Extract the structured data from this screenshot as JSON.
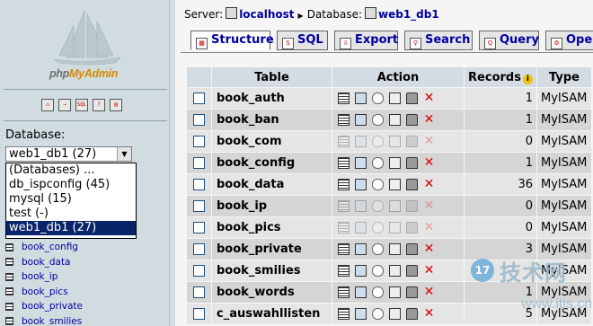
{
  "left": {
    "logo_php": "php",
    "logo_admin": "MyAdmin",
    "icons": [
      "home-icon",
      "exit-icon",
      "sql-query-icon",
      "help-icon",
      "docs-icon"
    ],
    "database_label": "Database:",
    "database_selected": "web1_db1 (27)",
    "database_options": [
      "(Databases) ...",
      "db_ispconfig (45)",
      "mysql (15)",
      "test (-)",
      "web1_db1 (27)"
    ],
    "table_list": [
      "book_config",
      "book_data",
      "book_ip",
      "book_pics",
      "book_private",
      "book_smilies"
    ]
  },
  "breadcrumb": {
    "server_label": "Server:",
    "server": "localhost",
    "database_label": "Database:",
    "database": "web1_db1"
  },
  "tabs": [
    {
      "label": "Structure",
      "icon": "structure-icon",
      "active": true
    },
    {
      "label": "SQL",
      "icon": "sql-icon"
    },
    {
      "label": "Export",
      "icon": "export-icon"
    },
    {
      "label": "Search",
      "icon": "search-icon"
    },
    {
      "label": "Query",
      "icon": "query-icon"
    },
    {
      "label": "Oper",
      "icon": "operations-icon"
    }
  ],
  "table": {
    "headers": {
      "table": "Table",
      "action": "Action",
      "records": "Records",
      "type": "Type"
    },
    "rows": [
      {
        "name": "book_auth",
        "records": "1",
        "type": "MyISAM",
        "empty": false
      },
      {
        "name": "book_ban",
        "records": "1",
        "type": "MyISAM",
        "empty": false
      },
      {
        "name": "book_com",
        "records": "0",
        "type": "MyISAM",
        "empty": true
      },
      {
        "name": "book_config",
        "records": "1",
        "type": "MyISAM",
        "empty": false
      },
      {
        "name": "book_data",
        "records": "36",
        "type": "MyISAM",
        "empty": false
      },
      {
        "name": "book_ip",
        "records": "0",
        "type": "MyISAM",
        "empty": true
      },
      {
        "name": "book_pics",
        "records": "0",
        "type": "MyISAM",
        "empty": true
      },
      {
        "name": "book_private",
        "records": "3",
        "type": "MyISAM",
        "empty": false
      },
      {
        "name": "book_smilies",
        "records": "",
        "type": "MyISAM",
        "empty": false
      },
      {
        "name": "book_words",
        "records": "1",
        "type": "MyISAM",
        "empty": false
      },
      {
        "name": "c_auswahllisten",
        "records": "5",
        "type": "MyISAM",
        "empty": false
      }
    ]
  },
  "watermark": {
    "num": "17",
    "text": "技术网",
    "url": "www.itjs.cn"
  }
}
